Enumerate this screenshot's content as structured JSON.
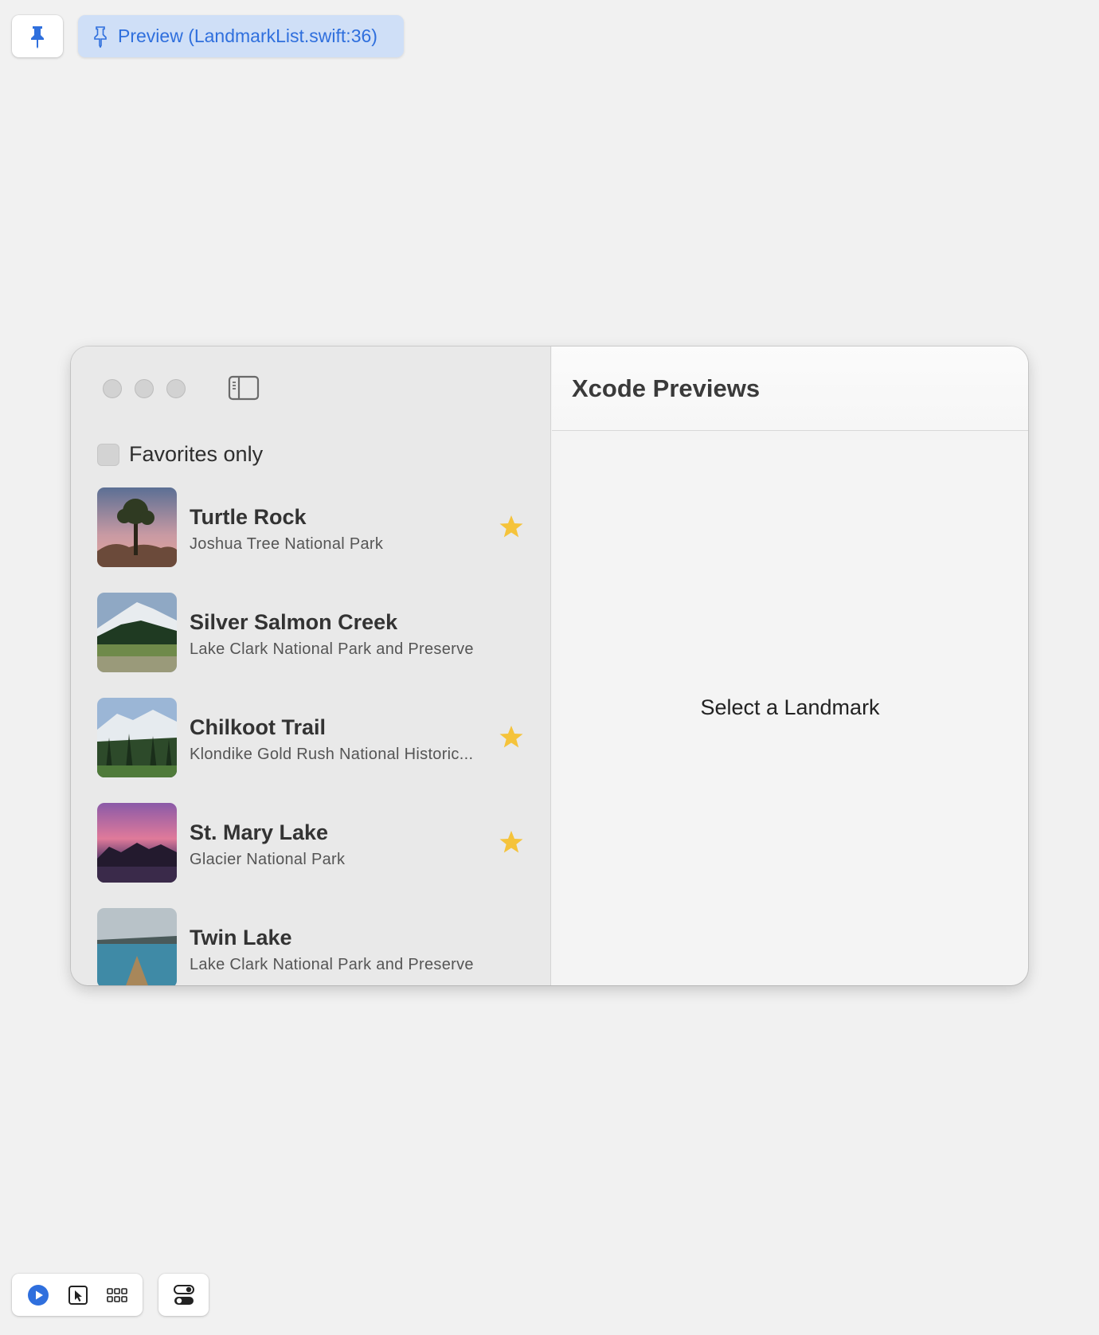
{
  "toolbar": {
    "pin_icon": "pin-icon",
    "preview_label": "Preview (LandmarkList.swift:36)",
    "accent": "#2f6fdd",
    "chip_bg": "#cfdff7"
  },
  "window": {
    "favorites_label": "Favorites only",
    "favorites_checked": false,
    "detail_title": "Xcode Previews",
    "empty_message": "Select a Landmark",
    "landmarks": [
      {
        "name": "Turtle Rock",
        "park": "Joshua Tree National Park",
        "favorite": true
      },
      {
        "name": "Silver Salmon Creek",
        "park": "Lake Clark National Park and Preserve",
        "favorite": false
      },
      {
        "name": "Chilkoot Trail",
        "park": "Klondike Gold Rush National Historic...",
        "favorite": true
      },
      {
        "name": "St. Mary Lake",
        "park": "Glacier National Park",
        "favorite": true
      },
      {
        "name": "Twin Lake",
        "park": "Lake Clark National Park and Preserve",
        "favorite": false
      }
    ],
    "star_color": "#f5c33b"
  },
  "bottom_toolbar": {
    "icons": [
      "play-icon",
      "select-cursor-icon",
      "grid-icon",
      "variants-icon"
    ]
  }
}
